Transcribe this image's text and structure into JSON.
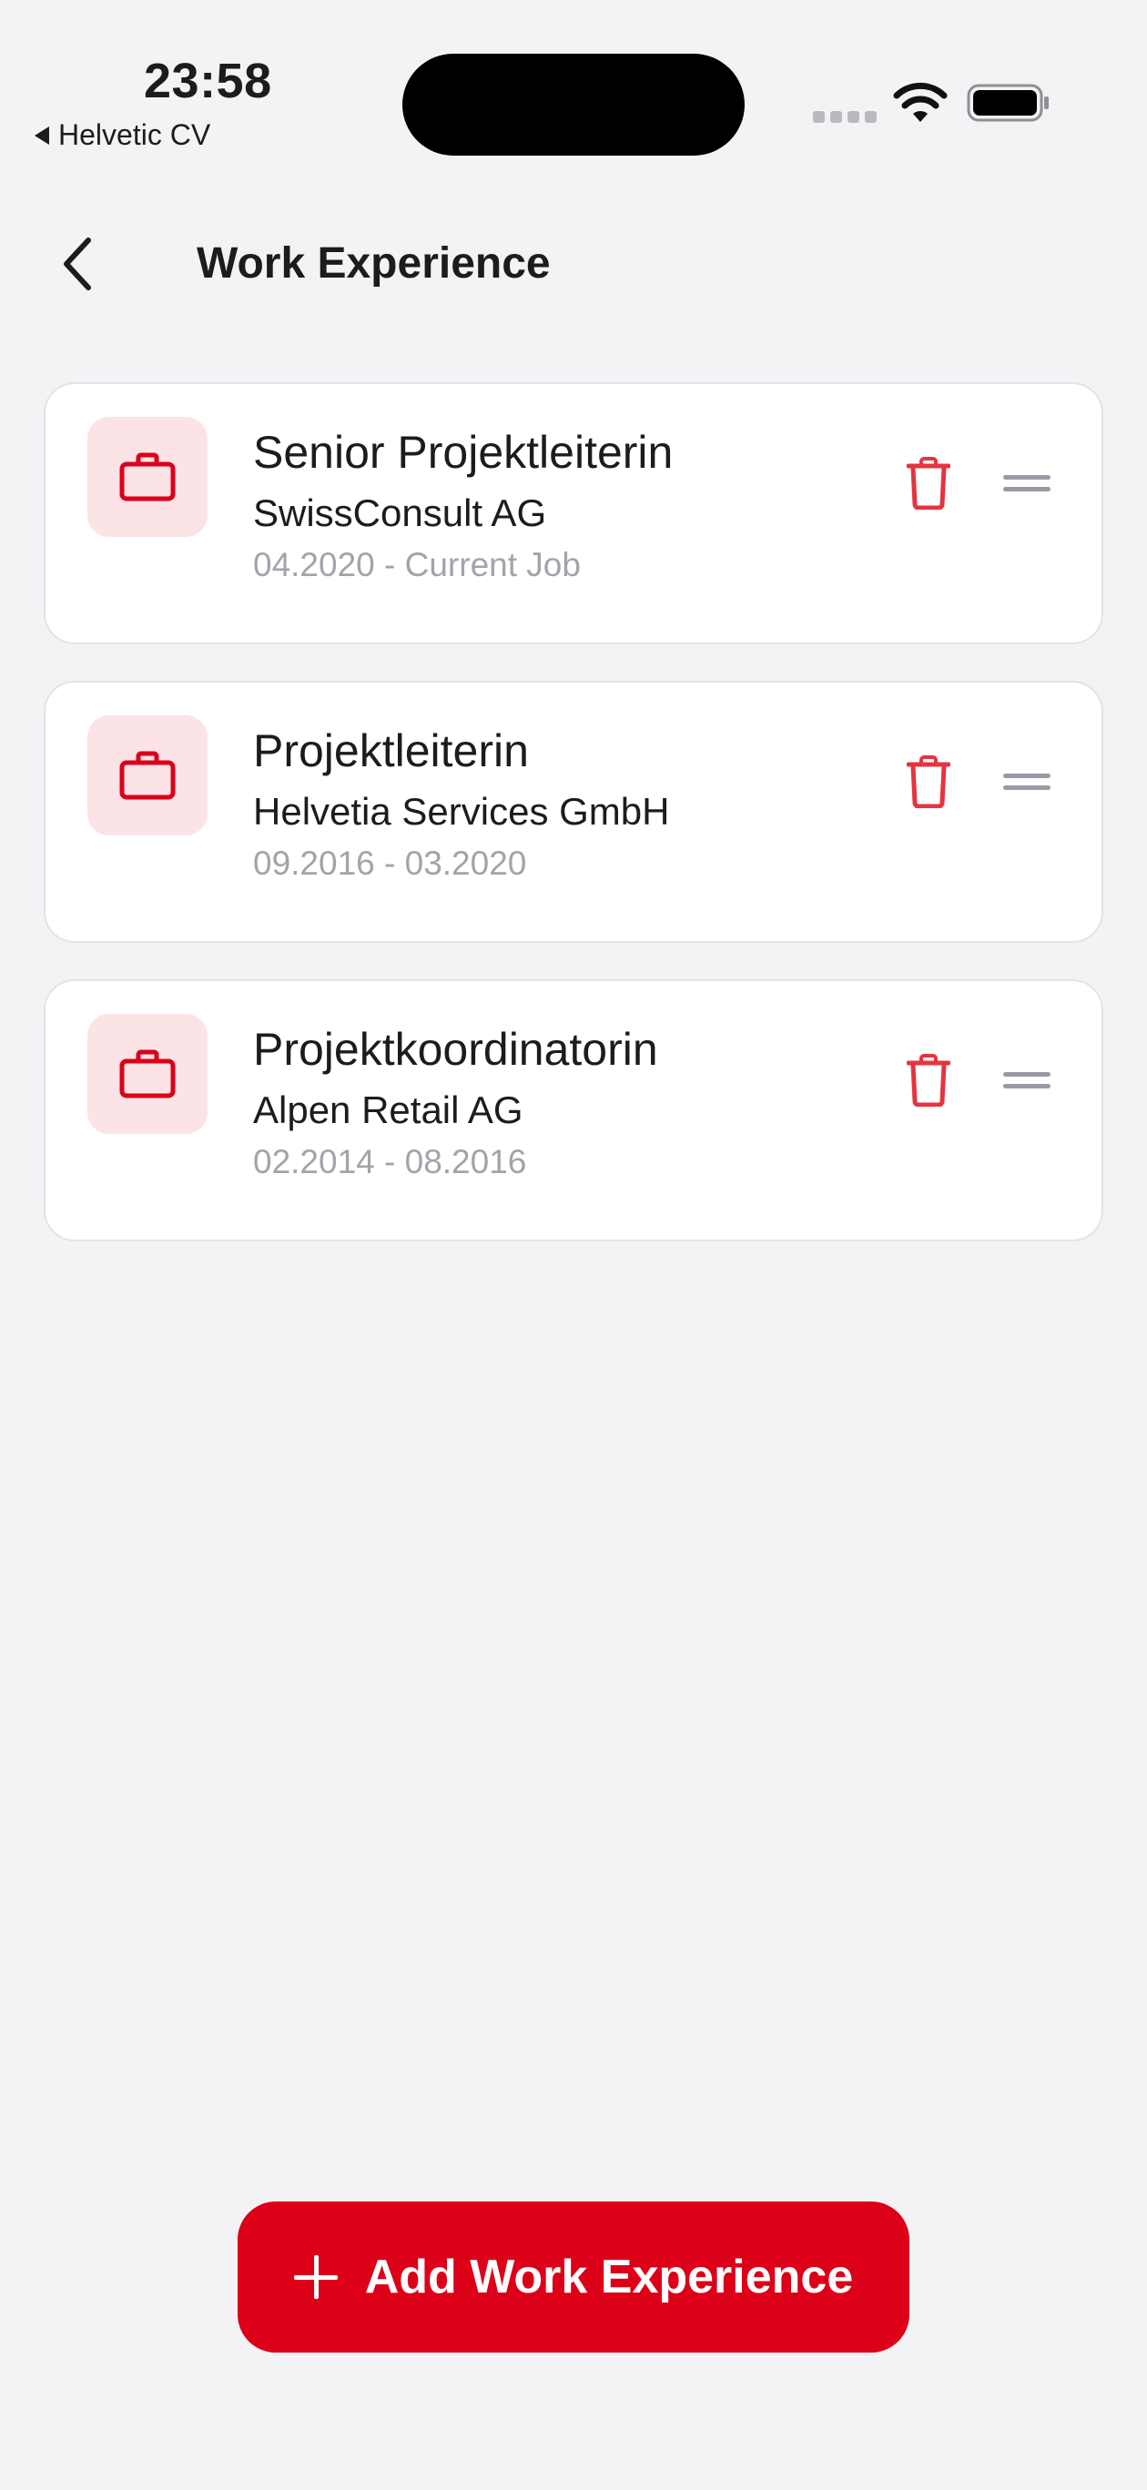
{
  "status_bar": {
    "time": "23:58",
    "back_app_label": "Helvetic CV"
  },
  "nav": {
    "title": "Work Experience"
  },
  "experiences": [
    {
      "title": "Senior Projektleiterin",
      "company": "SwissConsult AG",
      "dates": "04.2020 - Current Job"
    },
    {
      "title": "Projektleiterin",
      "company": "Helvetia Services GmbH",
      "dates": "09.2016 - 03.2020"
    },
    {
      "title": "Projektkoordinatorin",
      "company": "Alpen Retail AG",
      "dates": "02.2014 - 08.2016"
    }
  ],
  "add_button": {
    "label": "Add Work Experience"
  },
  "colors": {
    "accent": "#dc0018",
    "icon_bg": "#fbe3e6",
    "trash": "#e5343f",
    "drag_handle": "#9a9aa6",
    "secondary_text": "#a3a3aa",
    "background": "#f3f3f6"
  },
  "icons": {
    "job": "briefcase-icon",
    "delete": "trash-icon",
    "reorder": "drag-handle-icon",
    "back": "chevron-left-icon",
    "add": "plus-icon"
  }
}
